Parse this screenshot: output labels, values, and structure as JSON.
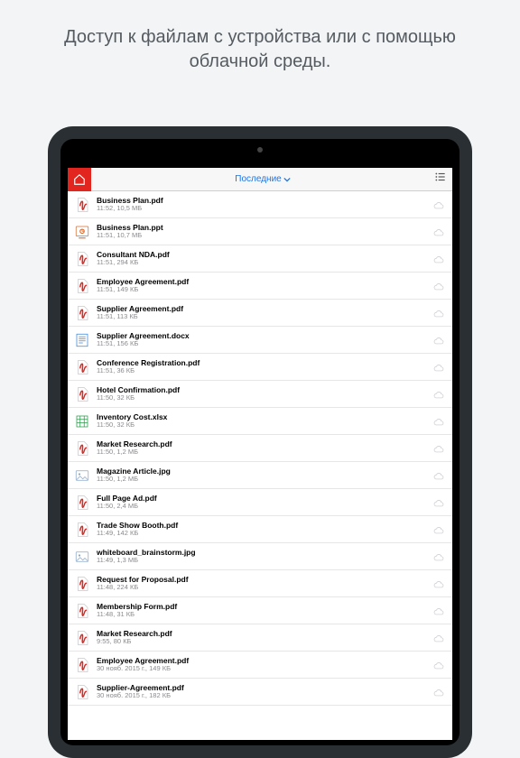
{
  "headline": "Доступ к файлам с устройства или с помощью облачной среды.",
  "navbar": {
    "title": "Последние"
  },
  "files": [
    {
      "icon": "pdf",
      "name": "Business Plan.pdf",
      "detail": "11:52, 10,5 МБ"
    },
    {
      "icon": "ppt",
      "name": "Business Plan.ppt",
      "detail": "11:51, 10,7 МБ"
    },
    {
      "icon": "pdf",
      "name": "Consultant NDA.pdf",
      "detail": "11:51, 294 КБ"
    },
    {
      "icon": "pdf",
      "name": "Employee Agreement.pdf",
      "detail": "11:51, 149 КБ"
    },
    {
      "icon": "pdf",
      "name": "Supplier Agreement.pdf",
      "detail": "11:51, 113 КБ"
    },
    {
      "icon": "docx",
      "name": "Supplier Agreement.docx",
      "detail": "11:51, 156 КБ"
    },
    {
      "icon": "pdf",
      "name": "Conference Registration.pdf",
      "detail": "11:51, 36 КБ"
    },
    {
      "icon": "pdf",
      "name": "Hotel Confirmation.pdf",
      "detail": "11:50, 32 КБ"
    },
    {
      "icon": "xlsx",
      "name": "Inventory Cost.xlsx",
      "detail": "11:50, 32 КБ"
    },
    {
      "icon": "pdf",
      "name": "Market Research.pdf",
      "detail": "11:50, 1,2 МБ"
    },
    {
      "icon": "jpg",
      "name": "Magazine Article.jpg",
      "detail": "11:50, 1,2 МБ"
    },
    {
      "icon": "pdf",
      "name": "Full Page Ad.pdf",
      "detail": "11:50, 2,4 МБ"
    },
    {
      "icon": "pdf",
      "name": "Trade Show Booth.pdf",
      "detail": "11:49, 142 КБ"
    },
    {
      "icon": "jpg",
      "name": "whiteboard_brainstorm.jpg",
      "detail": "11:49, 1,3 МБ"
    },
    {
      "icon": "pdf",
      "name": "Request for Proposal.pdf",
      "detail": "11:48, 224 КБ"
    },
    {
      "icon": "pdf",
      "name": "Membership Form.pdf",
      "detail": "11:48, 31 КБ"
    },
    {
      "icon": "pdf",
      "name": "Market Research.pdf",
      "detail": "9:55, 80 КБ"
    },
    {
      "icon": "pdf",
      "name": "Employee Agreement.pdf",
      "detail": "30 нояб. 2015 г., 149 КБ"
    },
    {
      "icon": "pdf",
      "name": "Supplier-Agreement.pdf",
      "detail": "30 нояб. 2015 г., 182 КБ"
    }
  ]
}
